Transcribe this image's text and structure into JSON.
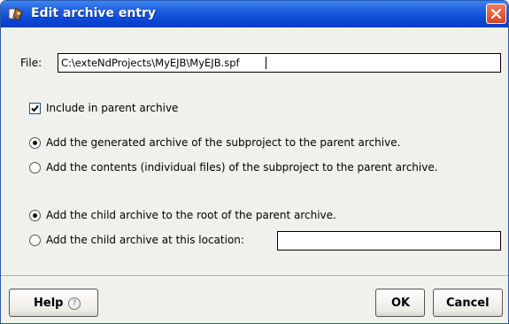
{
  "window": {
    "title": "Edit archive entry"
  },
  "file": {
    "label": "File:",
    "value": "C:\\exteNdProjects\\MyEJB\\MyEJB.spf"
  },
  "include": {
    "label": "Include in parent archive",
    "checked": true
  },
  "mode_options": [
    {
      "label": "Add the generated archive of the subproject to the parent archive.",
      "selected": true
    },
    {
      "label": "Add the contents (individual files) of the subproject to the parent archive.",
      "selected": false
    }
  ],
  "location_options": [
    {
      "label": "Add the child archive to the root of the parent archive.",
      "selected": true
    },
    {
      "label": "Add the child archive at this location:",
      "selected": false
    }
  ],
  "location_field": {
    "value": ""
  },
  "buttons": {
    "help": "Help",
    "help_icon": "?",
    "ok": "OK",
    "cancel": "Cancel"
  }
}
